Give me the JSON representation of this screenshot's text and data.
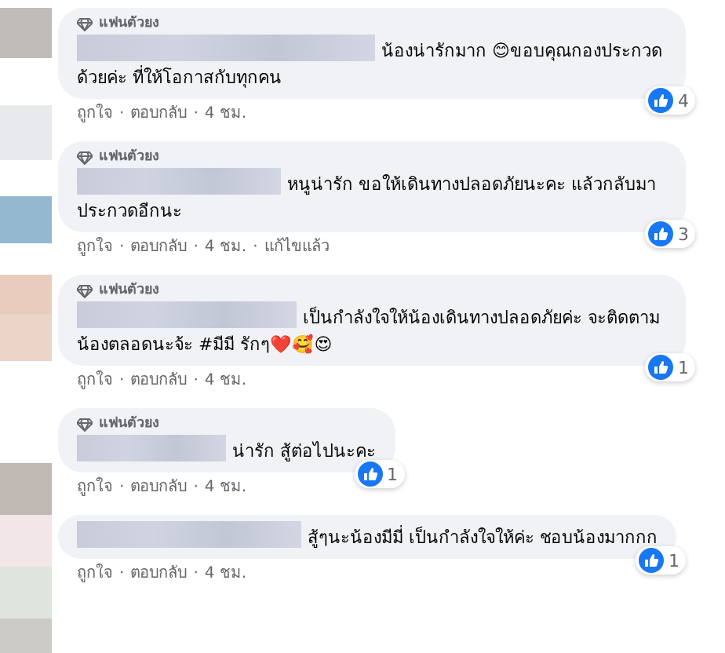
{
  "separator": "·",
  "comments": [
    {
      "badge": "แฟนตัวยง",
      "text": "น้องน่ารักมาก 😊ขอบคุณกองประกวดด้วยค่ะ ที่ให้โอกาสกับทุกคน",
      "likes": "4",
      "like": "ถูกใจ",
      "reply": "ตอบกลับ",
      "time": "4 ชม."
    },
    {
      "badge": "แฟนตัวยง",
      "text": "หนูน่ารัก ขอให้เดินทางปลอดภัยนะคะ แล้วกลับมาประกวดอีกนะ",
      "likes": "3",
      "like": "ถูกใจ",
      "reply": "ตอบกลับ",
      "time": "4 ชม.",
      "edited": "แก้ไขแล้ว"
    },
    {
      "badge": "แฟนตัวยง",
      "text": "เป็นกำลังใจให้น้องเดินทางปลอดภัยค่ะ จะติดตามน้องตลอดนะจ้ะ #มีมี รักๆ❤️🥰😍",
      "likes": "1",
      "like": "ถูกใจ",
      "reply": "ตอบกลับ",
      "time": "4 ชม."
    },
    {
      "badge": "แฟนตัวยง",
      "text": "น่ารัก สู้ต่อไปนะคะ",
      "likes": "1",
      "like": "ถูกใจ",
      "reply": "ตอบกลับ",
      "time": "4 ชม."
    },
    {
      "text": "สู้ๆนะน้องมีมี่ เป็นกำลังใจให้ค่ะ ชอบน้องมากกก",
      "likes": "1",
      "like": "ถูกใจ",
      "reply": "ตอบกลับ",
      "time": "4 ชม."
    }
  ]
}
